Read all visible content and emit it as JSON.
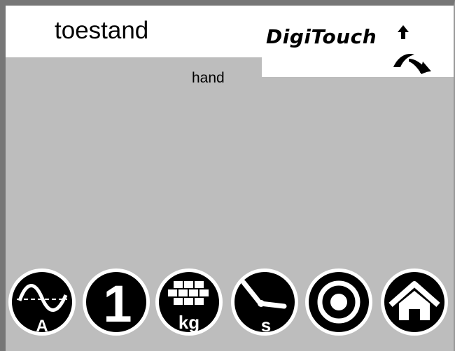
{
  "screen": {
    "title": "toestand",
    "state": "hand"
  },
  "logo": {
    "text": "DigiTouch"
  },
  "toolbar": {
    "buttons": [
      {
        "name": "current-sine-icon",
        "label": "A"
      },
      {
        "name": "number-one-icon",
        "label": "1"
      },
      {
        "name": "weight-bricks-icon",
        "label": "kg"
      },
      {
        "name": "clock-seconds-icon",
        "label": "s"
      },
      {
        "name": "target-ring-icon",
        "label": ""
      },
      {
        "name": "home-icon",
        "label": ""
      }
    ]
  },
  "colors": {
    "background": "#bdbdbd",
    "panel": "#ffffff",
    "frame": "#777777",
    "icon": "#000000"
  }
}
